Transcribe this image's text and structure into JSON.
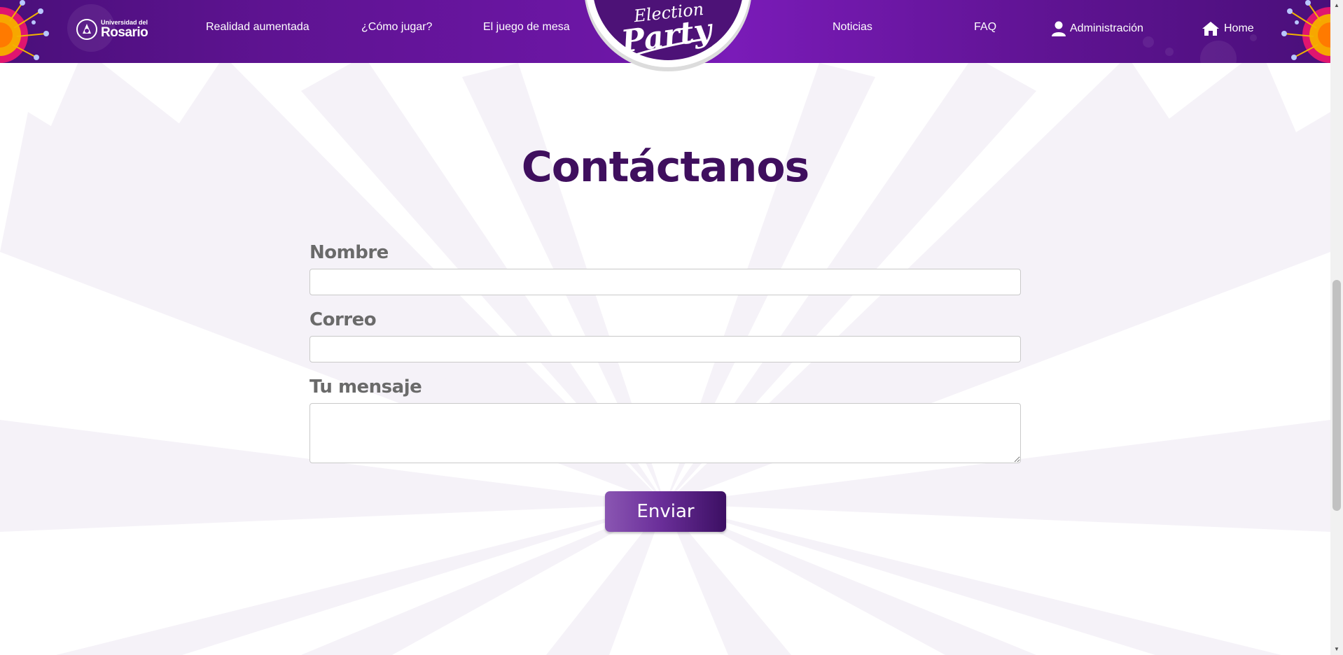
{
  "nav": {
    "brand_small": "Universidad del",
    "brand_big": "Rosario",
    "links": [
      {
        "label": "Realidad aumentada"
      },
      {
        "label": "¿Cómo jugar?"
      },
      {
        "label": "El juego de mesa"
      },
      {
        "label": "Noticias"
      },
      {
        "label": "FAQ"
      },
      {
        "label": "Administración",
        "icon": "user-icon"
      },
      {
        "label": "Home",
        "icon": "home-icon"
      }
    ],
    "badge_line1": "Election",
    "badge_line2": "Party"
  },
  "page": {
    "title": "Contáctanos"
  },
  "form": {
    "name_label": "Nombre",
    "name_value": "",
    "email_label": "Correo",
    "email_value": "",
    "message_label": "Tu mensaje",
    "message_value": "",
    "submit_label": "Enviar"
  },
  "colors": {
    "nav_purple": "#5e1391",
    "title_purple": "#3f0f5e",
    "button_start": "#8a56b2",
    "button_end": "#3c0f63"
  }
}
